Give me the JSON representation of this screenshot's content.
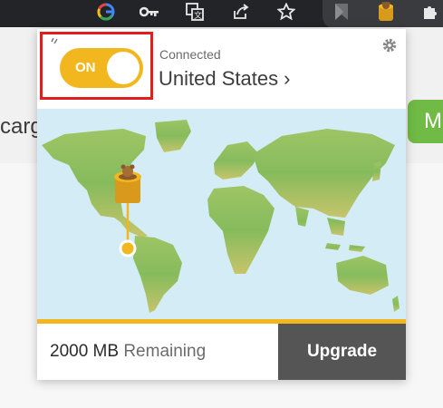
{
  "browser_toolbar": {
    "icons": [
      "google-icon",
      "key-icon",
      "translate-icon",
      "share-icon",
      "star-icon",
      "bookmark-icon",
      "tunnelbear-extension-icon",
      "puzzle-icon"
    ]
  },
  "background_page": {
    "text_fragment": "carg",
    "button_fragment": "M"
  },
  "popup": {
    "toggle": {
      "label": "ON",
      "state": "on"
    },
    "status": "Connected",
    "country": "United States",
    "country_chevron": "›",
    "data_remaining": {
      "amount": "2000 MB",
      "label": "Remaining"
    },
    "upgrade_label": "Upgrade"
  },
  "colors": {
    "accent_yellow": "#f2b71e",
    "highlight_red": "#e11d1d",
    "upgrade_bg": "#555555",
    "map_ocean": "#d3ecf5",
    "land_green": "#8cbf58"
  }
}
